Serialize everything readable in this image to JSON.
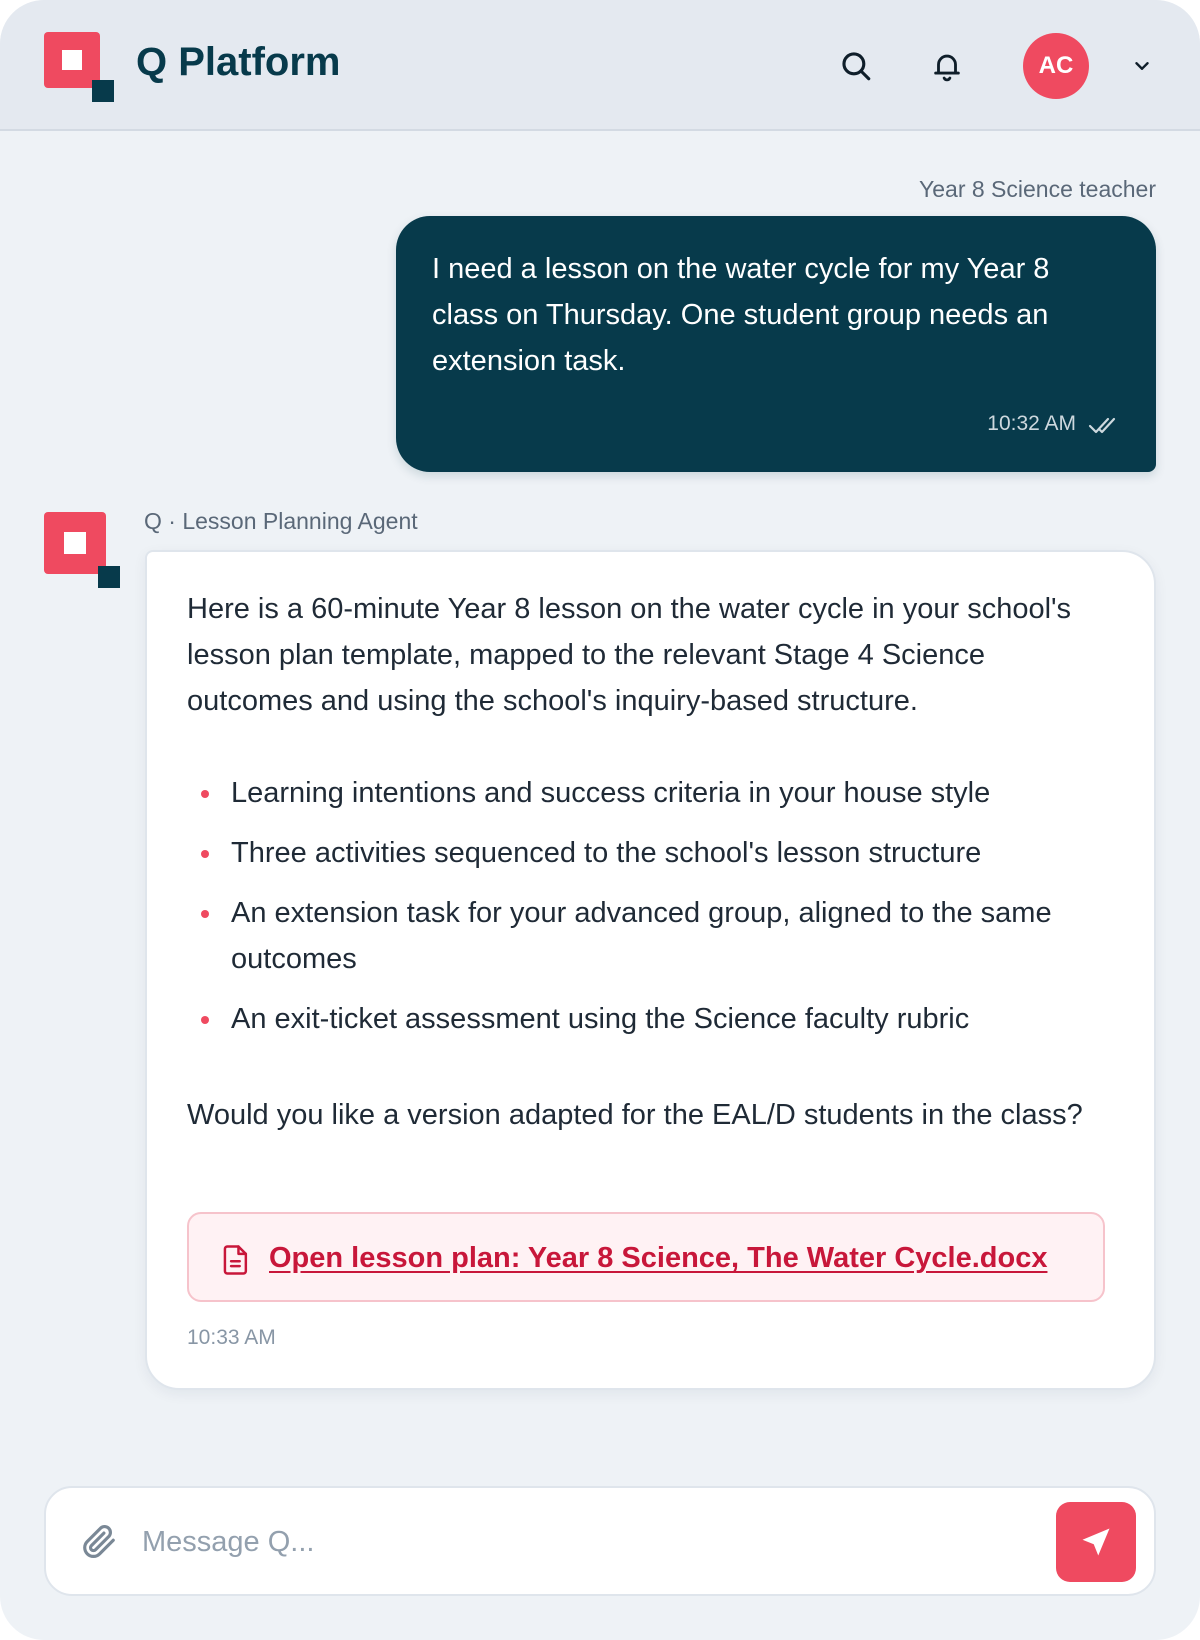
{
  "header": {
    "brand": "Q Platform",
    "icons": [
      "search-icon",
      "bell-icon",
      "chevron-down-icon"
    ],
    "avatar_initials": "AC"
  },
  "colors": {
    "accent": "#ef4a60",
    "navy": "#073a4b",
    "link": "#c8173a",
    "background": "#eef2f6"
  },
  "user_message": {
    "sender": "Year 8 Science teacher",
    "text": "I need a lesson on the water cycle for my Year 8 class on Thursday. One student group needs an extension task.",
    "time": "10:32 AM"
  },
  "agent_message": {
    "sender": "Q · Lesson Planning Agent",
    "intro": "Here is a 60-minute Year 8 lesson on the water cycle in your school's lesson plan template, mapped to the relevant Stage 4 Science outcomes and using the school's inquiry-based structure.",
    "bullets": [
      "Learning intentions and success criteria in your house style",
      "Three activities sequenced to the school's lesson structure",
      "An extension task for your advanced group, aligned to the same outcomes",
      "An exit-ticket assessment using the Science faculty rubric"
    ],
    "outro": "Would you like a version adapted for the EAL/D students in the class?",
    "attachment_label": "Open lesson plan: Year 8 Science, The Water Cycle.docx",
    "time": "10:33 AM"
  },
  "composer": {
    "placeholder": "Message Q...",
    "value": ""
  }
}
